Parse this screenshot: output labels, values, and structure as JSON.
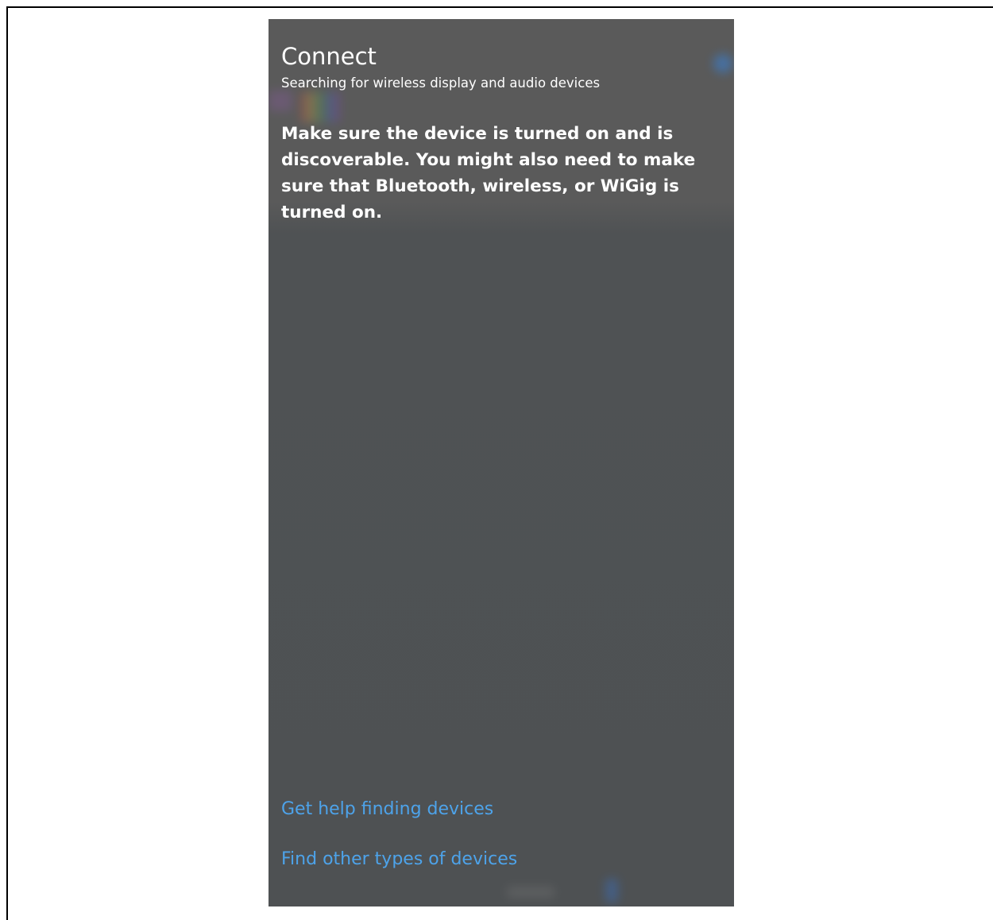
{
  "panel": {
    "title": "Connect",
    "subtitle": "Searching for wireless display and audio devices",
    "message": "Make sure the device is turned on and is discoverable. You might also need to make sure that Bluetooth, wireless, or WiGig is turned on."
  },
  "links": {
    "help": "Get help finding devices",
    "other": "Find other types of devices"
  },
  "colors": {
    "panel_bg": "#4e5153",
    "link": "#4da3ea",
    "text": "#ffffff"
  }
}
